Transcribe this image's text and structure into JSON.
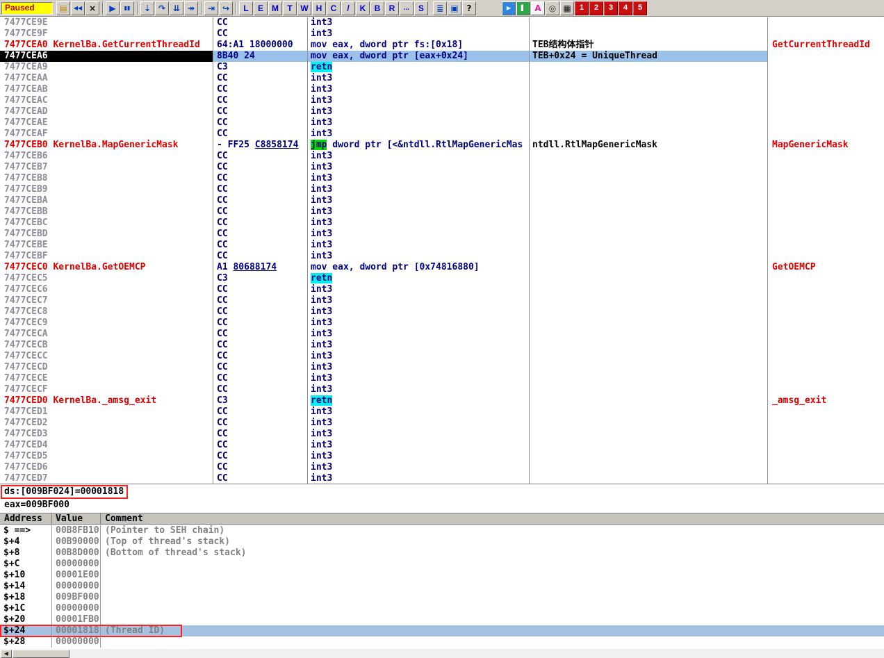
{
  "colors": {
    "selection_blue": "#9AC1EC",
    "stack_selection_blue": "#A5C2E2",
    "label_red": "#E00000",
    "retn_highlight": "#00F0F0",
    "jmp_highlight": "#00DC00",
    "annotation_red": "#FF2020",
    "status_bg": "#FFFF00",
    "status_fg": "#CC0000",
    "code_navy": "#000080"
  },
  "toolbar": {
    "status": "Paused",
    "buttons": [
      {
        "type": "icon",
        "name": "open-file-button",
        "icon": "folder-open-icon",
        "glyph": "▤",
        "color": "#B8860B"
      },
      {
        "type": "icon",
        "name": "restart-button",
        "icon": "restart-icon",
        "glyph": "◀◀",
        "color": "#0040C0",
        "small": true
      },
      {
        "type": "icon",
        "name": "close-button",
        "icon": "close-icon",
        "glyph": "×",
        "color": "#101010"
      },
      {
        "type": "sep"
      },
      {
        "type": "icon",
        "name": "run-button",
        "icon": "play-icon",
        "glyph": "▶",
        "color": "#0040C0"
      },
      {
        "type": "icon",
        "name": "pause-button",
        "icon": "pause-icon",
        "glyph": "▮▮",
        "color": "#0040C0",
        "small": true
      },
      {
        "type": "sep"
      },
      {
        "type": "icon",
        "name": "step-into-button",
        "icon": "step-into-icon",
        "glyph": "⇣",
        "color": "#0040C0"
      },
      {
        "type": "icon",
        "name": "step-over-button",
        "icon": "step-over-icon",
        "glyph": "↷",
        "color": "#0040C0"
      },
      {
        "type": "icon",
        "name": "animate-into-button",
        "icon": "animate-into-icon",
        "glyph": "⇊",
        "color": "#0040C0"
      },
      {
        "type": "icon",
        "name": "animate-over-button",
        "icon": "animate-over-icon",
        "glyph": "↠",
        "color": "#0040C0"
      },
      {
        "type": "sep"
      },
      {
        "type": "icon",
        "name": "execute-till-return-button",
        "icon": "till-return-icon",
        "glyph": "⇥",
        "color": "#0040C0"
      },
      {
        "type": "icon",
        "name": "execute-till-user-button",
        "icon": "till-user-icon",
        "glyph": "↪",
        "color": "#0040C0"
      },
      {
        "type": "sep"
      },
      {
        "type": "letter",
        "name": "view-log-button",
        "label": "L"
      },
      {
        "type": "letter",
        "name": "view-executables-button",
        "label": "E"
      },
      {
        "type": "letter",
        "name": "view-memory-button",
        "label": "M"
      },
      {
        "type": "letter",
        "name": "view-threads-button",
        "label": "T"
      },
      {
        "type": "letter",
        "name": "view-windows-button",
        "label": "W"
      },
      {
        "type": "letter",
        "name": "view-handles-button",
        "label": "H"
      },
      {
        "type": "letter",
        "name": "view-cpu-button",
        "label": "C"
      },
      {
        "type": "letter",
        "name": "view-patches-button",
        "label": "/"
      },
      {
        "type": "letter",
        "name": "view-call-stack-button",
        "label": "K"
      },
      {
        "type": "letter",
        "name": "view-breakpoints-button",
        "label": "B"
      },
      {
        "type": "letter",
        "name": "view-references-button",
        "label": "R"
      },
      {
        "type": "letter",
        "name": "view-run-trace-button",
        "label": "..."
      },
      {
        "type": "letter",
        "name": "view-source-button",
        "label": "S"
      },
      {
        "type": "gap",
        "px": 6
      },
      {
        "type": "icon",
        "name": "log-list-button",
        "icon": "list-icon",
        "glyph": "≣",
        "color": "#0040C0"
      },
      {
        "type": "icon",
        "name": "tile-windows-button",
        "icon": "tiles-icon",
        "glyph": "▣",
        "color": "#0040C0"
      },
      {
        "type": "icon",
        "name": "help-button",
        "icon": "question-icon",
        "glyph": "?",
        "color": "#101010"
      },
      {
        "type": "gap",
        "px": 36
      },
      {
        "type": "plug",
        "name": "plugin-blue-button",
        "icon": "blue-plugin-icon",
        "glyph": "▶",
        "bg": "#2E86E0",
        "fg": "#FFFFFF",
        "small": true
      },
      {
        "type": "plug",
        "name": "plugin-green-button",
        "icon": "green-plugin-icon",
        "glyph": "▌",
        "bg": "#2FA848",
        "fg": "#FFFFFF",
        "small": true
      },
      {
        "type": "plug",
        "name": "plugin-a-button",
        "icon": "letter-a-icon",
        "glyph": "A",
        "bg": "#F4F4F4",
        "fg": "#E0249A"
      },
      {
        "type": "plug",
        "name": "plugin-circle-button",
        "icon": "circle-icon",
        "glyph": "◎",
        "fg": "#303030"
      },
      {
        "type": "plug",
        "name": "plugin-grid-button",
        "icon": "grid-icon",
        "glyph": "▦",
        "fg": "#101010"
      },
      {
        "type": "num",
        "name": "desktop-1-button",
        "icon": "digit-1-icon",
        "glyph": "1"
      },
      {
        "type": "num",
        "name": "desktop-2-button",
        "icon": "digit-2-icon",
        "glyph": "2"
      },
      {
        "type": "num",
        "name": "desktop-3-button",
        "icon": "digit-3-icon",
        "glyph": "3"
      },
      {
        "type": "num",
        "name": "desktop-4-button",
        "icon": "digit-4-icon",
        "glyph": "4"
      },
      {
        "type": "num",
        "name": "desktop-5-button",
        "icon": "digit-5-icon",
        "glyph": "5"
      }
    ]
  },
  "disasm": {
    "rows": [
      {
        "addr": "7477CE9E",
        "bytes": "CC",
        "instr": "int3"
      },
      {
        "addr": "7477CE9F",
        "bytes": "CC",
        "instr": "int3"
      },
      {
        "addr": "7477CEA0",
        "label": "KernelBa.GetCurrentThreadId",
        "bytes": "64:A1 18000000",
        "instr": "mov eax, dword ptr fs:[0x18]",
        "comment": "TEB结构体指针",
        "fn": "GetCurrentThreadId"
      },
      {
        "addr": "7477CEA6",
        "sel": true,
        "bytes": "8B40 24",
        "instr": "mov eax, dword ptr [eax+0x24]",
        "comment": "TEB+0x24 = UniqueThread"
      },
      {
        "addr": "7477CEA9",
        "bytes": "C3",
        "op": "retn",
        "hl": "cyan"
      },
      {
        "addr": "7477CEAA",
        "bytes": "CC",
        "instr": "int3"
      },
      {
        "addr": "7477CEAB",
        "bytes": "CC",
        "instr": "int3"
      },
      {
        "addr": "7477CEAC",
        "bytes": "CC",
        "instr": "int3"
      },
      {
        "addr": "7477CEAD",
        "bytes": "CC",
        "instr": "int3"
      },
      {
        "addr": "7477CEAE",
        "bytes": "CC",
        "instr": "int3"
      },
      {
        "addr": "7477CEAF",
        "bytes": "CC",
        "instr": "int3"
      },
      {
        "addr": "7477CEB0",
        "label": "KernelBa.MapGenericMask",
        "bytes": "- FF25 ",
        "bytes_u": "C8858174",
        "op": "jmp",
        "hl": "green",
        "instr": " dword ptr [<&ntdll.RtlMapGenericMas",
        "comment": "ntdll.RtlMapGenericMask",
        "fn": "MapGenericMask"
      },
      {
        "addr": "7477CEB6",
        "bytes": "CC",
        "instr": "int3"
      },
      {
        "addr": "7477CEB7",
        "bytes": "CC",
        "instr": "int3"
      },
      {
        "addr": "7477CEB8",
        "bytes": "CC",
        "instr": "int3"
      },
      {
        "addr": "7477CEB9",
        "bytes": "CC",
        "instr": "int3"
      },
      {
        "addr": "7477CEBA",
        "bytes": "CC",
        "instr": "int3"
      },
      {
        "addr": "7477CEBB",
        "bytes": "CC",
        "instr": "int3"
      },
      {
        "addr": "7477CEBC",
        "bytes": "CC",
        "instr": "int3"
      },
      {
        "addr": "7477CEBD",
        "bytes": "CC",
        "instr": "int3"
      },
      {
        "addr": "7477CEBE",
        "bytes": "CC",
        "instr": "int3"
      },
      {
        "addr": "7477CEBF",
        "bytes": "CC",
        "instr": "int3"
      },
      {
        "addr": "7477CEC0",
        "label": "KernelBa.GetOEMCP",
        "bytes": "A1 ",
        "bytes_u": "80688174",
        "instr": "mov eax, dword ptr [0x74816880]",
        "fn": "GetOEMCP"
      },
      {
        "addr": "7477CEC5",
        "bytes": "C3",
        "op": "retn",
        "hl": "cyan"
      },
      {
        "addr": "7477CEC6",
        "bytes": "CC",
        "instr": "int3"
      },
      {
        "addr": "7477CEC7",
        "bytes": "CC",
        "instr": "int3"
      },
      {
        "addr": "7477CEC8",
        "bytes": "CC",
        "instr": "int3"
      },
      {
        "addr": "7477CEC9",
        "bytes": "CC",
        "instr": "int3"
      },
      {
        "addr": "7477CECA",
        "bytes": "CC",
        "instr": "int3"
      },
      {
        "addr": "7477CECB",
        "bytes": "CC",
        "instr": "int3"
      },
      {
        "addr": "7477CECC",
        "bytes": "CC",
        "instr": "int3"
      },
      {
        "addr": "7477CECD",
        "bytes": "CC",
        "instr": "int3"
      },
      {
        "addr": "7477CECE",
        "bytes": "CC",
        "instr": "int3"
      },
      {
        "addr": "7477CECF",
        "bytes": "CC",
        "instr": "int3"
      },
      {
        "addr": "7477CED0",
        "label": "KernelBa._amsg_exit",
        "bytes": "C3",
        "op": "retn",
        "hl": "cyan",
        "fn": "_amsg_exit"
      },
      {
        "addr": "7477CED1",
        "bytes": "CC",
        "instr": "int3"
      },
      {
        "addr": "7477CED2",
        "bytes": "CC",
        "instr": "int3"
      },
      {
        "addr": "7477CED3",
        "bytes": "CC",
        "instr": "int3"
      },
      {
        "addr": "7477CED4",
        "bytes": "CC",
        "instr": "int3"
      },
      {
        "addr": "7477CED5",
        "bytes": "CC",
        "instr": "int3"
      },
      {
        "addr": "7477CED6",
        "bytes": "CC",
        "instr": "int3"
      },
      {
        "addr": "7477CED7",
        "bytes": "CC",
        "instr": "int3"
      }
    ]
  },
  "info": {
    "line1": "ds:[009BF024]=00001818",
    "line2": "eax=009BF000"
  },
  "stack": {
    "headers": [
      "Address",
      "Value",
      "Comment"
    ],
    "rows": [
      {
        "addr": "$ ==>",
        "value": "00B8FB10",
        "comment": "(Pointer to SEH chain)"
      },
      {
        "addr": "$+4",
        "value": "00B90000",
        "comment": "(Top of thread's stack)"
      },
      {
        "addr": "$+8",
        "value": "00B8D000",
        "comment": "(Bottom of thread's stack)"
      },
      {
        "addr": "$+C",
        "value": "00000000",
        "comment": ""
      },
      {
        "addr": "$+10",
        "value": "00001E00",
        "comment": ""
      },
      {
        "addr": "$+14",
        "value": "00000000",
        "comment": ""
      },
      {
        "addr": "$+18",
        "value": "009BF000",
        "comment": ""
      },
      {
        "addr": "$+1C",
        "value": "00000000",
        "comment": ""
      },
      {
        "addr": "$+20",
        "value": "00001FB0",
        "comment": ""
      },
      {
        "addr": "$+24",
        "value": "00001818",
        "comment": "(Thread ID)",
        "sel": true,
        "boxed": true
      },
      {
        "addr": "$+28",
        "value": "00000000",
        "comment": ""
      }
    ]
  },
  "scrollbar": {
    "left_arrow": "◀"
  }
}
